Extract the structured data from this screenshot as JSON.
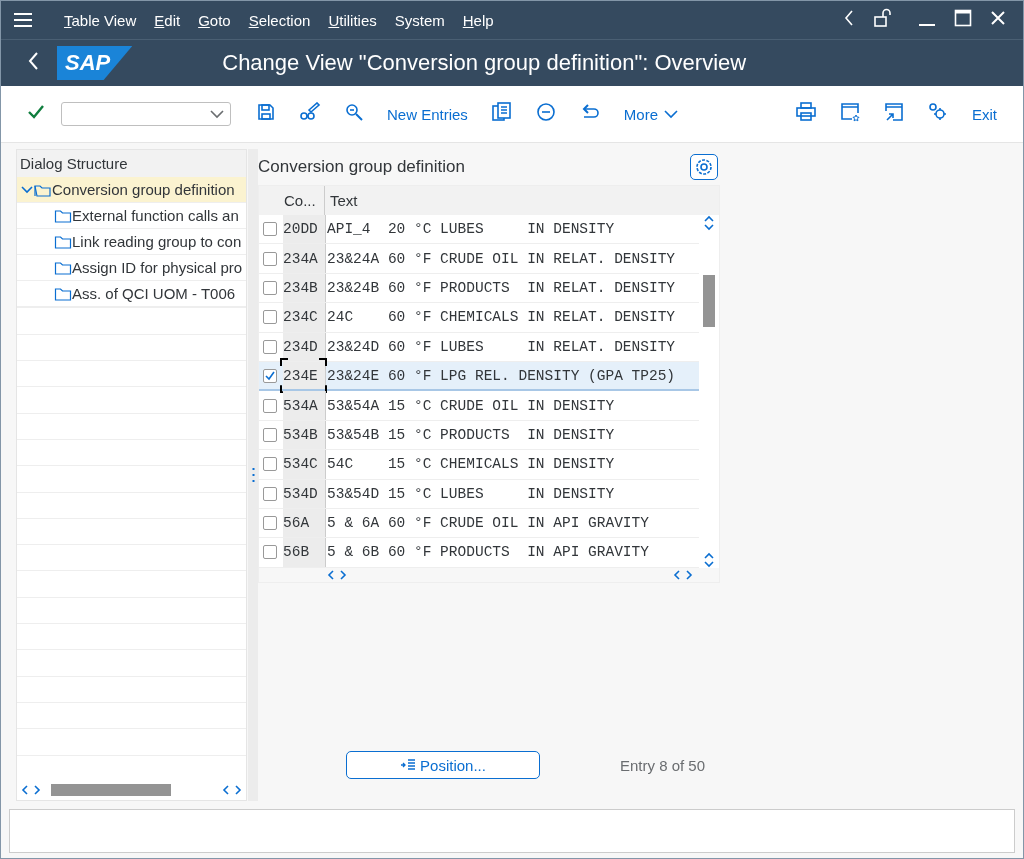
{
  "menu": [
    {
      "label": "Table View",
      "first_letter_underlined": true
    },
    {
      "label": "Edit",
      "first_letter_underlined": true
    },
    {
      "label": "Goto",
      "first_letter_underlined": true
    },
    {
      "label": "Selection",
      "first_letter_underlined": true
    },
    {
      "label": "Utilities",
      "first_letter_underlined": true
    },
    {
      "label": "System",
      "first_letter_underlined": false
    },
    {
      "label": "Help",
      "first_letter_underlined": true
    }
  ],
  "header": {
    "logo": "SAP",
    "title": "Change View \"Conversion group definition\": Overview"
  },
  "toolbar": {
    "new_entries": "New Entries",
    "more": "More",
    "exit": "Exit"
  },
  "dialog_structure": {
    "title": "Dialog Structure",
    "tree": [
      {
        "label": "Conversion group definition",
        "selected": true,
        "expanded": true,
        "children": [
          {
            "label": "External function calls an",
            "selected": false
          },
          {
            "label": "Link reading group to con",
            "selected": false
          },
          {
            "label": "Assign ID for physical pro",
            "selected": false
          },
          {
            "label": "Ass. of QCI UOM - T006",
            "selected": false
          }
        ]
      }
    ]
  },
  "table": {
    "title": "Conversion group definition",
    "columns": [
      "Co...",
      "Text"
    ],
    "rows": [
      {
        "code": "20DD",
        "text": "API_4  20 °C LUBES     IN DENSITY",
        "selected": false
      },
      {
        "code": "234A",
        "text": "23&24A 60 °F CRUDE OIL IN RELAT. DENSITY",
        "selected": false
      },
      {
        "code": "234B",
        "text": "23&24B 60 °F PRODUCTS  IN RELAT. DENSITY",
        "selected": false
      },
      {
        "code": "234C",
        "text": "24C    60 °F CHEMICALS IN RELAT. DENSITY",
        "selected": false
      },
      {
        "code": "234D",
        "text": "23&24D 60 °F LUBES     IN RELAT. DENSITY",
        "selected": false
      },
      {
        "code": "234E",
        "text": "23&24E 60 °F LPG REL. DENSITY (GPA TP25)",
        "selected": true
      },
      {
        "code": "534A",
        "text": "53&54A 15 °C CRUDE OIL IN DENSITY",
        "selected": false
      },
      {
        "code": "534B",
        "text": "53&54B 15 °C PRODUCTS  IN DENSITY",
        "selected": false
      },
      {
        "code": "534C",
        "text": "54C    15 °C CHEMICALS IN DENSITY",
        "selected": false
      },
      {
        "code": "534D",
        "text": "53&54D 15 °C LUBES     IN DENSITY",
        "selected": false
      },
      {
        "code": "56A",
        "text": "5 & 6A 60 °F CRUDE OIL IN API GRAVITY",
        "selected": false
      },
      {
        "code": "56B",
        "text": "5 & 6B 60 °F PRODUCTS  IN API GRAVITY",
        "selected": false
      }
    ]
  },
  "position_button": "Position...",
  "entry_info": "Entry 8 of 50"
}
